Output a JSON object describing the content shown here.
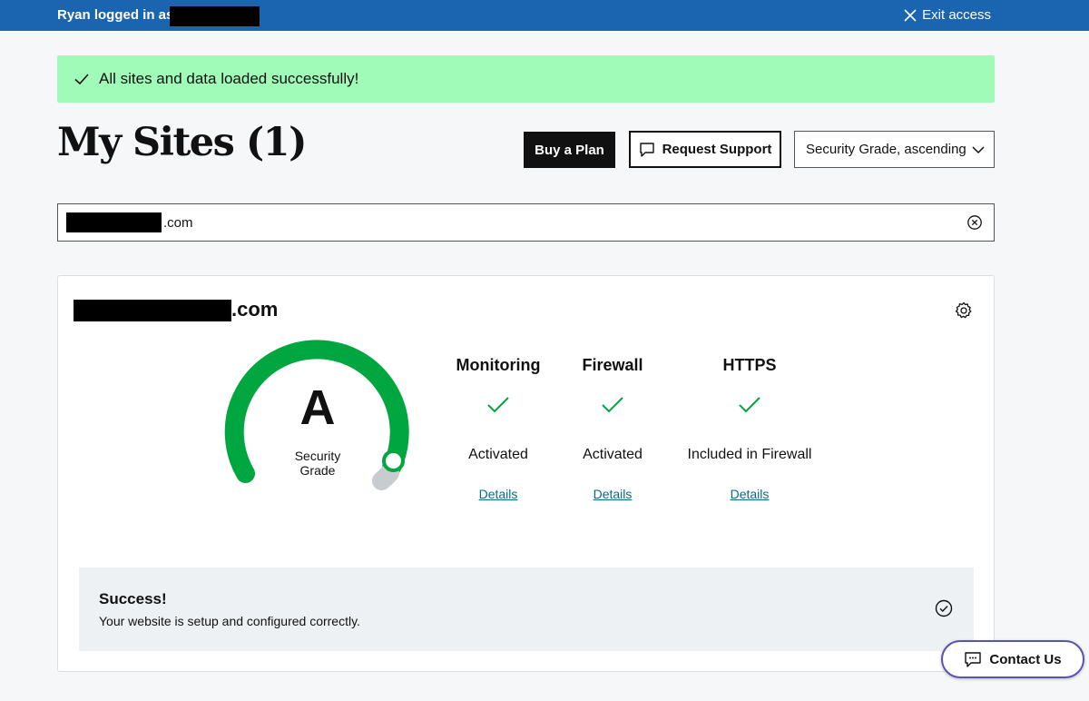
{
  "topbar": {
    "logged_in_text": "Ryan logged in as:",
    "exit_label": "Exit access"
  },
  "alert": {
    "message": "All sites and data loaded successfully!"
  },
  "page": {
    "title": "My Sites (1)"
  },
  "actions": {
    "buy_label": "Buy a Plan",
    "support_label": "Request Support",
    "sort_value": "Security Grade, ascending"
  },
  "search": {
    "value_suffix": ".com"
  },
  "site": {
    "name_suffix": ".com",
    "grade": "A",
    "grade_label_line1": "Security",
    "grade_label_line2": "Grade",
    "features": [
      {
        "title": "Monitoring",
        "status": "Activated",
        "link": "Details"
      },
      {
        "title": "Firewall",
        "status": "Activated",
        "link": "Details"
      },
      {
        "title": "HTTPS",
        "status": "Included in Firewall",
        "link": "Details"
      }
    ],
    "success": {
      "title": "Success!",
      "description": "Your website is setup and configured correctly."
    }
  },
  "contact": {
    "label": "Contact Us"
  },
  "colors": {
    "topbar": "#1b64b0",
    "alert_bg": "#9ffbb7",
    "gauge_green": "#00a63f",
    "link": "#0a6c7e",
    "contact_border": "#5a52b5"
  }
}
